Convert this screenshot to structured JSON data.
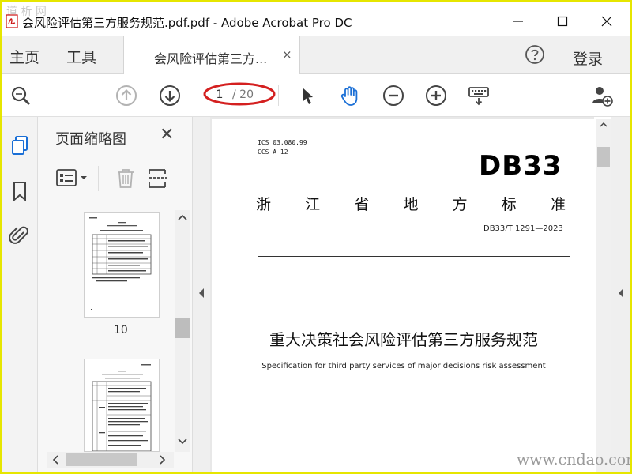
{
  "window": {
    "title": "会风险评估第三方服务规范.pdf.pdf - Adobe Acrobat Pro DC",
    "watermark_top": "道 析 网"
  },
  "tabs": {
    "home": "主页",
    "tools": "工具",
    "document": "会风险评估第三方...",
    "close": "×",
    "login": "登录"
  },
  "toolbar": {
    "current_page": "1",
    "total_pages": "/ 20"
  },
  "thumbnails": {
    "title": "页面缩略图",
    "close": "✕",
    "pages": [
      {
        "number": "10"
      }
    ]
  },
  "document": {
    "ics": "ICS  03.080.99",
    "ccs": "CCS  A 12",
    "code": "DB33",
    "province_chars": [
      "浙",
      "江",
      "省",
      "地",
      "方",
      "标",
      "准"
    ],
    "standard_number": "DB33/T 1291—2023",
    "title_cn": "重大决策社会风险评估第三方服务规范",
    "title_en": "Specification for third party services of major decisions risk assessment"
  },
  "watermark": "www.cndao.com",
  "colors": {
    "accent_blue": "#1a6fd6",
    "icon_gray": "#444444",
    "disabled_gray": "#b3b3b3",
    "annotation_red": "#d42020",
    "outer_frame": "#e6e600"
  }
}
